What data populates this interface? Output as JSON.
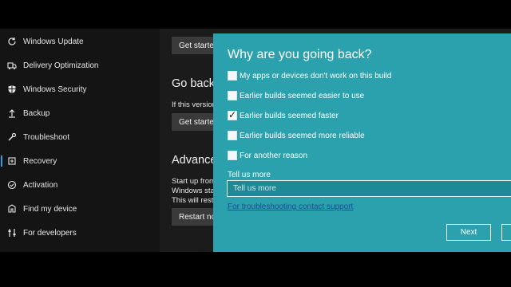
{
  "sidebar": {
    "items": [
      {
        "label": "Windows Update",
        "icon": "sync-icon"
      },
      {
        "label": "Delivery Optimization",
        "icon": "delivery-optimization-icon"
      },
      {
        "label": "Windows Security",
        "icon": "shield-icon"
      },
      {
        "label": "Backup",
        "icon": "backup-arrow-icon"
      },
      {
        "label": "Troubleshoot",
        "icon": "wrench-icon"
      },
      {
        "label": "Recovery",
        "icon": "recovery-icon",
        "active": true
      },
      {
        "label": "Activation",
        "icon": "check-circle-icon"
      },
      {
        "label": "Find my device",
        "icon": "find-device-icon"
      },
      {
        "label": "For developers",
        "icon": "developer-tools-icon"
      }
    ],
    "accent_color": "#3a9bd9"
  },
  "content": {
    "get_started_top": "Get started",
    "go_back_heading": "Go back t",
    "go_back_text": "If this version",
    "get_started_mid": "Get started",
    "advanced_heading": "Advanced",
    "advanced_line1": "Start up from",
    "advanced_line2": "Windows star",
    "advanced_line3": "This will resta",
    "restart_button": "Restart now"
  },
  "dialog": {
    "background_color": "#2aa1ac",
    "title": "Why are you going back?",
    "options": [
      {
        "label": "My apps or devices don't work on this build",
        "checked": false
      },
      {
        "label": "Earlier builds seemed easier to use",
        "checked": false
      },
      {
        "label": "Earlier builds seemed faster",
        "checked": true
      },
      {
        "label": "Earlier builds seemed more reliable",
        "checked": false
      },
      {
        "label": "For another reason",
        "checked": false
      }
    ],
    "check_glyph": "✓",
    "tell_us_label": "Tell us more",
    "tell_us_placeholder": "Tell us more",
    "support_link": "For troubleshooting contact support",
    "next_button": "Next"
  }
}
